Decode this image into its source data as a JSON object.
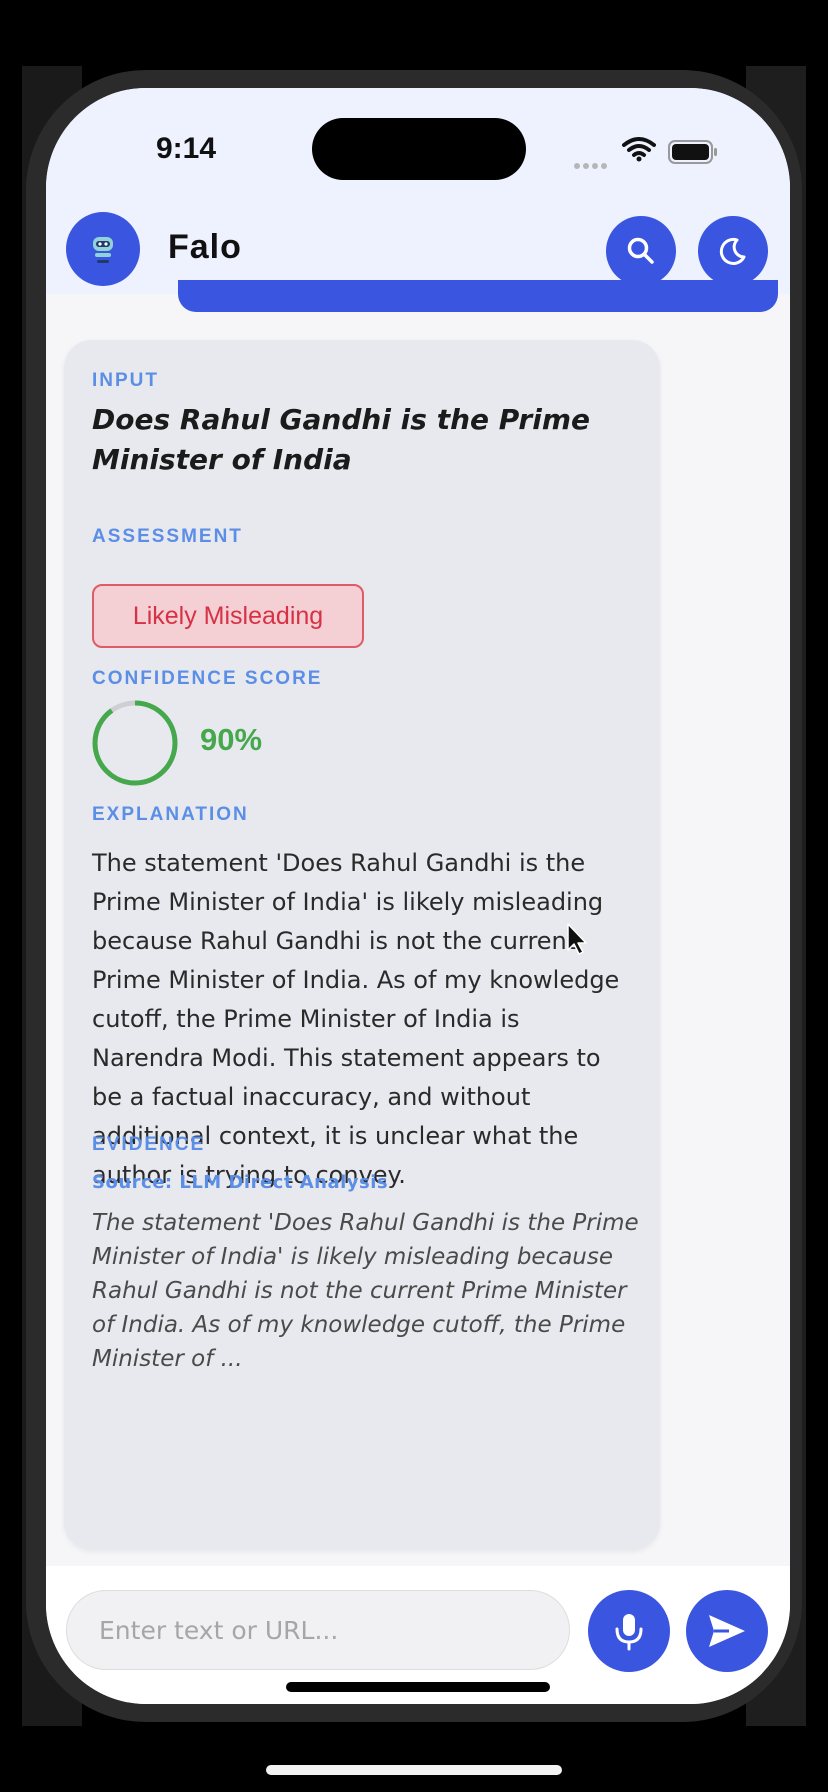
{
  "status_bar": {
    "time": "9:14"
  },
  "header": {
    "title": "Falo"
  },
  "result_card": {
    "input_label": "INPUT",
    "input_text": "Does Rahul Gandhi is the Prime Minister of India",
    "assessment_label": "ASSESSMENT",
    "assessment_value": "Likely Misleading",
    "confidence_label": "CONFIDENCE SCORE",
    "confidence_value": "90%",
    "confidence_fraction": 0.9,
    "explanation_label": "EXPLANATION",
    "explanation_text": "The statement 'Does Rahul Gandhi is the Prime Minister of India' is likely misleading because Rahul Gandhi is not the current Prime Minister of India. As of my knowledge cutoff, the Prime Minister of India is Narendra Modi. This statement appears to be a factual inaccuracy, and without additional context, it is unclear what the author is trying to convey.",
    "evidence_label": "EVIDENCE",
    "evidence_source": "Source: LLM Direct Analysis",
    "evidence_text": "The statement 'Does Rahul Gandhi is the Prime Minister of India' is likely misleading because Rahul Gandhi is not the current Prime Minister of India. As of my knowledge cutoff, the Prime Minister of ..."
  },
  "composer": {
    "placeholder": "Enter text or URL..."
  },
  "colors": {
    "accent": "#3a55e0",
    "label": "#5b8ee6",
    "misleading_text": "#d63144",
    "misleading_bg": "#f4cfd3",
    "confidence": "#45a84c"
  },
  "icons": {
    "logo": "robot-icon",
    "search": "search-icon",
    "theme": "moon-icon",
    "mic": "microphone-icon",
    "send": "send-icon"
  }
}
